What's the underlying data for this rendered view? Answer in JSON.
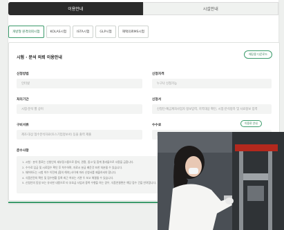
{
  "tabs": [
    {
      "label": "이용안내",
      "active": true
    },
    {
      "label": "시설안내",
      "active": false
    }
  ],
  "chips": [
    "개방형 원격의뢰시험",
    "KOLAS시험",
    "ISTA시험",
    "GLP시험",
    "재택의료MS시험"
  ],
  "card": {
    "title": "시험 · 분석 의뢰 이용안내",
    "top_button": "해당용 다운로드",
    "fields": [
      {
        "label": "신청방법",
        "value": "인터넷"
      },
      {
        "label": "신청자격",
        "value": "누구나 신청가능"
      },
      {
        "label": "처리기간",
        "value": "시험·분석 별 상이"
      },
      {
        "label": "신청서",
        "value": "신청인·예금계좌사업자 정보입력, 지역대상 확인, 시험·분석정하 및 사료정보 입력"
      },
      {
        "label": "구비서류",
        "value": "제조·대상 협수분석자료(토스기업정보서) 등을 출력 제출"
      },
      {
        "label": "수수료",
        "value": "한국식품연구원 시험·분석 수수료 규정에 따름"
      }
    ],
    "fee_button": "이용료 안내",
    "notes_title": "준수사항",
    "notes": [
      "1. 시험 · 분석 종료는 신청인의 세부정그름으로 중지, 관찰, 중고 및 합계 결과물으로 사용을 금합니다.",
      "2. 수수료 입금 및 시료접수 확인 후 착수하며, 자료시 분급 배운것 또한 처분될 수 있습니다.",
      "3. 채취하도는 시험 착수 이전에 [협의 해야] 사이에 따라 신청서를 제출하셔야 합니다.",
      "4. 식품안전의 확인 및 접수현황 등록 최근 여부는 기관 두 보고 해결될 수 있습니다.",
      "5. 신청인의 동일 또는 유사한 내용으로 타 부호급 사업과 중복 수행을 하는 경우, 식품연결편은 해당 접수 건을 반려합니다."
    ]
  }
}
